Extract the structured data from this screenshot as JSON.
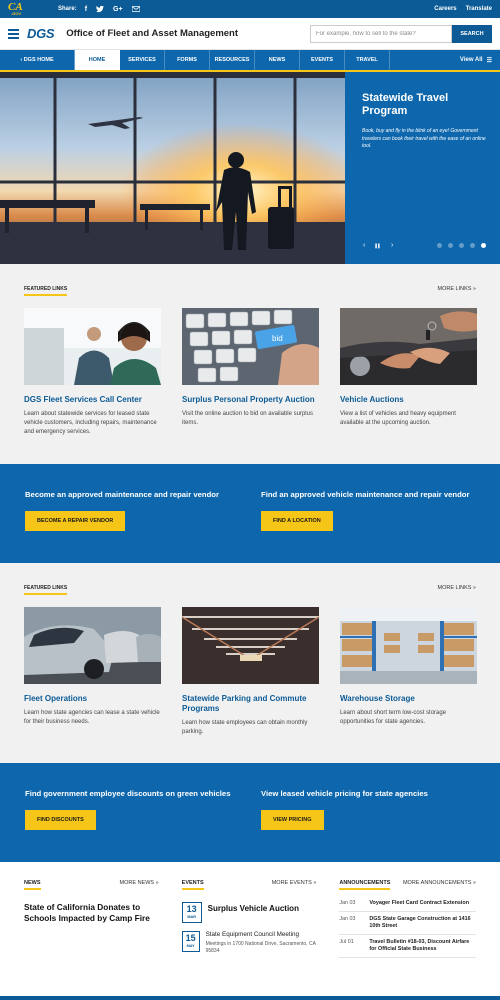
{
  "topbar": {
    "share_label": "Share:",
    "ca_logo_text": "CA",
    "ca_logo_sub": ".GOV",
    "social": [
      {
        "icon": "facebook-icon",
        "glyph": "f"
      },
      {
        "icon": "twitter-icon",
        "glyph": "t"
      },
      {
        "icon": "google-plus-icon",
        "glyph": "G+"
      },
      {
        "icon": "email-icon",
        "glyph": "mail"
      }
    ],
    "links": [
      "Careers",
      "Translate"
    ]
  },
  "header": {
    "logo": "DGS",
    "title": "Office of Fleet and Asset Management",
    "search_placeholder": "For example, how to sell to the state?",
    "search_button": "SEARCH"
  },
  "nav": {
    "home": "DGS HOME",
    "items": [
      "HOME",
      "SERVICES",
      "FORMS",
      "RESOURCES",
      "NEWS",
      "EVENTS",
      "TRAVEL"
    ],
    "active": "HOME",
    "view_all": "View All"
  },
  "hero": {
    "title": "Statewide Travel Program",
    "text": "Book, buy and fly in the blink of an eye! Government travelers can book their travel with the ease of an online tool.",
    "prev": "‹",
    "pause": "▌▌",
    "next": "›",
    "slides": 5,
    "active_slide": 5
  },
  "featured1": {
    "label": "FEATURED LINKS",
    "more": "MORE LINKS »",
    "cards": [
      {
        "title": "DGS Fleet Services Call Center",
        "text": "Learn about statewide services for leased state vehicle customers, including repairs, maintenance and emergency services."
      },
      {
        "title": "Surplus Personal Property Auction",
        "text": "Visit the online auction to bid on available surplus items."
      },
      {
        "title": "Vehicle Auctions",
        "text": "View a list of vehicles and heavy equipment available at the upcoming auction."
      }
    ],
    "keyboard_key": "bid"
  },
  "band1": {
    "left": {
      "title": "Become an approved maintenance and repair vendor",
      "button": "BECOME A REPAIR VENDOR"
    },
    "right": {
      "title": "Find an approved vehicle maintenance and repair vendor",
      "button": "FIND A LOCATION"
    }
  },
  "featured2": {
    "label": "FEATURED LINKS",
    "more": "MORE LINKS »",
    "cards": [
      {
        "title": "Fleet Operations",
        "text": "Learn how state agencies can lease a state vehicle for their business needs."
      },
      {
        "title": "Statewide Parking and Commute Programs",
        "text": "Learn how state employees can obtain monthly parking."
      },
      {
        "title": "Warehouse Storage",
        "text": "Learn about short term low-cost storage opportunities for state agencies."
      }
    ]
  },
  "band2": {
    "left": {
      "title": "Find government employee discounts on green vehicles",
      "button": "FIND DISCOUNTS"
    },
    "right": {
      "title": "View leased vehicle pricing for state agencies",
      "button": "VIEW PRICING"
    }
  },
  "news": {
    "label": "NEWS",
    "more": "MORE NEWS »",
    "headline": "State of California Donates to Schools Impacted by Camp Fire"
  },
  "events": {
    "label": "EVENTS",
    "more": "MORE EVENTS »",
    "items": [
      {
        "day": "13",
        "month": "MAR",
        "title": "Surplus Vehicle Auction",
        "sub": ""
      },
      {
        "day": "15",
        "month": "MAY",
        "title": "State Equipment Council Meeting",
        "sub": "Meetings in 1700 National Drive, Sacramento, CA 95834"
      }
    ]
  },
  "announcements": {
    "label": "ANNOUNCEMENTS",
    "more": "MORE ANNOUNCEMENTS »",
    "items": [
      {
        "date": "Jan 03",
        "title": "Voyager Fleet Card Contract Extension"
      },
      {
        "date": "Jan 03",
        "title": "DGS State Garage Construction at 1416 10th Street"
      },
      {
        "date": "Jul 01",
        "title": "Travel Bulletin #18-03, Discount Airfare for Official State Business"
      }
    ]
  },
  "colors": {
    "primary": "#0c5b96",
    "nav": "#0e67ad",
    "accent": "#f5c518"
  }
}
